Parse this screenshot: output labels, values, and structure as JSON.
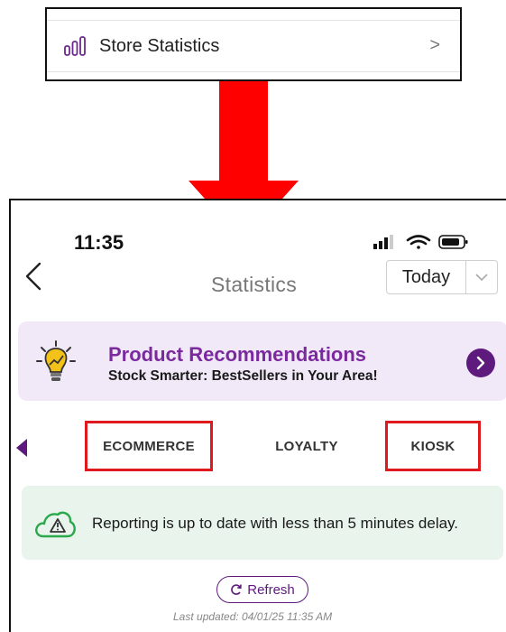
{
  "top_menu": {
    "label": "Store Statistics",
    "icon": "bar-chart-icon",
    "chevron": ">"
  },
  "status_bar": {
    "time": "11:35"
  },
  "header": {
    "title": "Statistics",
    "period_value": "Today"
  },
  "promo": {
    "headline": "Product Recommendations",
    "subtitle": "Stock Smarter: BestSellers in Your Area!",
    "icon": "lightbulb-icon"
  },
  "tabs": [
    {
      "label": "ECOMMERCE"
    },
    {
      "label": "LOYALTY"
    },
    {
      "label": "KIOSK"
    }
  ],
  "notice": {
    "message": "Reporting is up to date with less than 5 minutes delay.",
    "icon": "cloud-warning-icon"
  },
  "refresh": {
    "label": "Refresh"
  },
  "last_updated": "Last updated:  04/01/25  11:35 AM",
  "colors": {
    "accent_purple": "#5e1a7d",
    "headline_purple": "#7b2a9d",
    "promo_bg": "#f1e9f8",
    "notice_bg": "#e8f4ec",
    "highlight_red": "#e0191e",
    "arrow_red": "#ff0000"
  }
}
